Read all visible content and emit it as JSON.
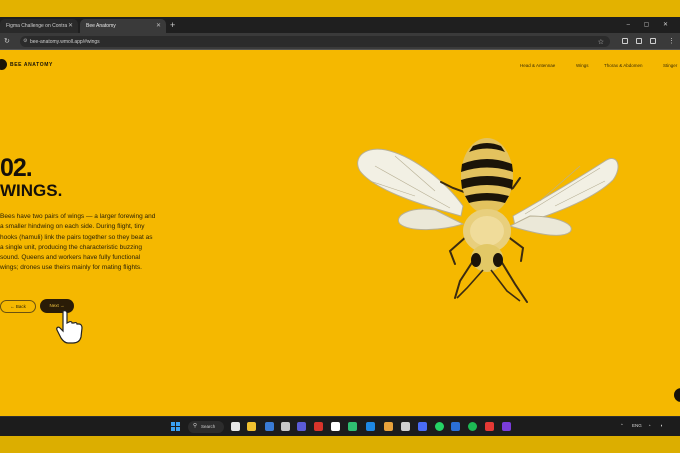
{
  "browser": {
    "tabs": [
      {
        "label": "Figma Challenge on Contra",
        "active": false
      },
      {
        "label": "Bee Anatomy",
        "active": true
      }
    ],
    "new_tab": "+",
    "window_controls": "–  ▢  ✕",
    "url": "bee-anatomy.wmoll.app/#wings"
  },
  "site": {
    "brand": "BEE ANATOMY",
    "nav": [
      "Head & Antennae",
      "Wings",
      "Thorax & Abdomen",
      "Stinger"
    ]
  },
  "section": {
    "number": "02.",
    "title": "WINGS.",
    "body_lines": [
      "Bees have two pairs of wings — a larger forewing and",
      "a smaller hindwing on each side. During flight, tiny",
      "hooks (hamuli) link the pairs together so they beat as",
      "a single unit, producing the characteristic buzzing",
      "sound. Queens and workers have fully functional",
      "wings; drones use theirs mainly for mating flights."
    ],
    "back_label": "← Back",
    "next_label": "Next →"
  },
  "taskbar": {
    "search_label": "Search",
    "lang": "ENG",
    "icons": [
      "file-explorer-icon",
      "widgets-icon",
      "edge-icon",
      "terminal-icon",
      "app-icon",
      "store-icon",
      "chrome-icon",
      "vscode-icon",
      "teams-icon",
      "photos-icon",
      "whatsapp-icon",
      "spotify-icon",
      "slack-icon",
      "app2-icon"
    ]
  },
  "colors": {
    "page_bg": "#f5b800",
    "text_dark": "#15100a",
    "next_btn_bg": "#2a1c07"
  }
}
